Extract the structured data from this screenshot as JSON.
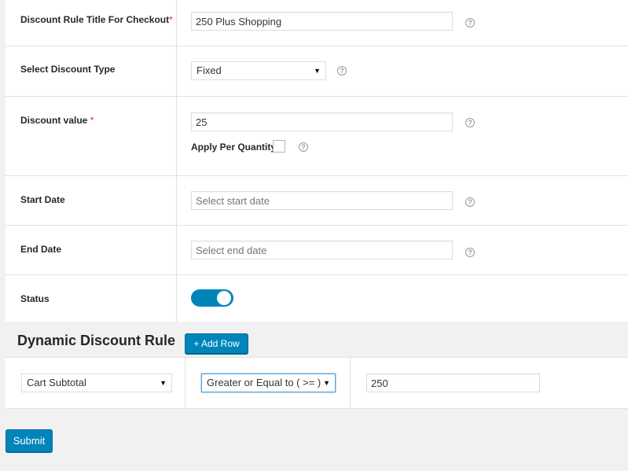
{
  "form": {
    "title_row": {
      "label": "Discount Rule Title For Checkout",
      "required_mark": "*",
      "value": "250 Plus Shopping"
    },
    "type_row": {
      "label": "Select Discount Type",
      "selected": "Fixed"
    },
    "value_row": {
      "label": "Discount value ",
      "required_mark": "*",
      "value": "25",
      "per_quantity_label": "Apply Per Quantity"
    },
    "start_row": {
      "label": "Start Date",
      "placeholder": "Select start date"
    },
    "end_row": {
      "label": "End Date",
      "placeholder": "Select end date"
    },
    "status_row": {
      "label": "Status",
      "enabled": true
    },
    "help_glyph": "?",
    "dropdown_glyph": "▼"
  },
  "dynamic": {
    "title": "Dynamic Discount Rule",
    "add_row_label": "+ Add Row",
    "condition": "Cart Subtotal",
    "operator": "Greater or Equal to ( >= )",
    "amount": "250"
  },
  "submit_label": "Submit",
  "colors": {
    "accent": "#0085ba",
    "required": "#dc3232",
    "background": "#f1f1f1"
  }
}
